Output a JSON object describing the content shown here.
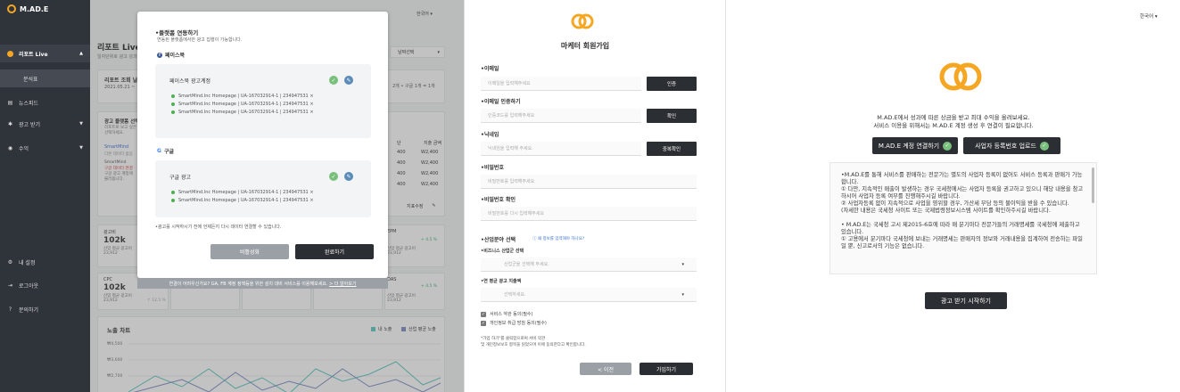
{
  "sidebar": {
    "logo": "M.AD.E",
    "items": [
      {
        "label": "리포트 Live",
        "icon": "report-icon"
      },
      {
        "label": "분석표",
        "icon": ""
      },
      {
        "label": "뉴스피드",
        "icon": "newsfeed-icon"
      },
      {
        "label": "광고 받기",
        "icon": "ad-icon"
      },
      {
        "label": "수익",
        "icon": "revenue-icon"
      }
    ],
    "bottom": [
      {
        "label": "내 설정",
        "icon": "gear-icon"
      },
      {
        "label": "로그아웃",
        "icon": "logout-icon"
      },
      {
        "label": "문의하기",
        "icon": "help-icon"
      }
    ]
  },
  "dashboard": {
    "lang": "한국어",
    "title": "리포트 Live",
    "subtitle": "일자단위로 광고 성과",
    "date_select": "날짜선택",
    "report_label": "리포트 조회 날짜",
    "report_date": "2021.05.21 ~",
    "report_right": "2개 • 구글 1개 = 1개",
    "platform_title": "광고 플랫폼 선택",
    "platform_desc1": "리포트로 보고 싶은",
    "platform_desc2": "선택하세요.",
    "smartmind": "SmartMind",
    "smartmind_sub": "다른 데이터 없음",
    "smartmind2": "SmartMind",
    "warn1": "구글 데이터 연결",
    "warn2": "구글 광고 계정에",
    "warn3": "불러옵니다.",
    "col_unit": "단",
    "col_amount": "지출 금액",
    "rows": [
      {
        "u": "400",
        "a": "W2,400"
      },
      {
        "u": "400",
        "a": "W2,400"
      },
      {
        "u": "400",
        "a": "W2,400"
      },
      {
        "u": "400",
        "a": "W2,400"
      }
    ],
    "edit_label": "지표수정",
    "metrics": [
      {
        "name": "광고비",
        "value": "102k",
        "sub1": "산업 평균 광고비",
        "sub2": "23,912",
        "pct": "↑ 12.5 %"
      },
      {
        "name": "EPM",
        "value": "",
        "sub1": "산업 평균 광고비",
        "sub2": "23,912",
        "pct": "+ 4.5 %"
      },
      {
        "name": "CPC",
        "value": "102k",
        "sub1": "산업 평균 광고비",
        "sub2": "23,912",
        "pct": "↑ 12.5 %"
      },
      {
        "name": "OAS",
        "value": "",
        "sub1": "산업 평균 광고비",
        "sub2": "23,912",
        "pct": "+ 4.5 %"
      }
    ],
    "chart_title": "노출 차트",
    "legend_a": "내 노출",
    "legend_b": "산업 평균 노출",
    "y_ticks": [
      "₩4,500",
      "₩3,600",
      "₩2,700"
    ]
  },
  "modal": {
    "title": "•플랫폼 연동하기",
    "desc": "연동된 플랫폼에서만 광고 집행이 가능합니다.",
    "facebook": "페이스북",
    "fb_account": "페이스북 광고계정",
    "google": "구글",
    "g_account": "구글 광고",
    "links": [
      "SmartMind.Inc Homepage | UA-167032914-1 | 234947531 ×",
      "SmartMind.Inc Homepage | UA-167032914-1 | 234947531 ×",
      "SmartMind.Inc Homepage | UA-167032914-1 | 234947531 ×"
    ],
    "glinks": [
      "SmartMind.Inc Homepage | UA-167032914-1 | 234947531 ×",
      "SmartMind.Inc Homepage | UA-167032914-1 | 234947531 ×"
    ],
    "note": "•광고를 시작하시기 전에 언제든지 다시 데이터 연결할 수 있습니다.",
    "btn_disable": "비활성화",
    "btn_done": "완료하기",
    "footnote": "연결이 어려우신가요? GA, FB 계정 정책등을 위한 설치 대비 서비스를 이용해보세요.",
    "footnote_link": "> 더 알아보기"
  },
  "signup": {
    "title": "마케터 회원가입",
    "email_label": "•이메일",
    "email_ph": "이메일을 입력해주세요",
    "email_btn": "인증",
    "verify_label": "•이메일 인증하기",
    "verify_ph": "인증코드를 입력해주세요",
    "verify_btn": "확인",
    "nick_label": "•닉네임",
    "nick_ph": "닉네임을 입력해 주세요.",
    "nick_btn": "중복확인",
    "pw_label": "•비밀번호",
    "pw_ph": "비밀번호를 입력해주세요",
    "pw2_label": "•비밀번호 확인",
    "pw2_ph": "비밀번호를 다시 입력해주세요",
    "industry_label": "•산업분야 선택",
    "industry_hint": "ⓘ 왜 정보를 입력해야 하나요?",
    "biz_label": "•비즈니스 산업군 선택",
    "biz_ph": "산업군을 선택해 주세요.",
    "budget_label": "•연 평균 광고 지출액",
    "budget_ph": "선택하세요.",
    "agree1": "서비스 약관 동의(필수)",
    "agree2": "개인정보 취급 방침 동의(필수)",
    "legal1": "*가입 하기\"를 클릭함으로써 서비 약관",
    "legal2": "및 개인정보보호 항목을 읽었으며 이에 동의한다고 확인합니다.",
    "prev": "< 이전",
    "submit": "가입하기"
  },
  "onboard": {
    "lang": "한국어",
    "line1": "M.AD.E에서 성과에 따른 상금을 받고 최대 수익을 올려보세요.",
    "line2": "서비스 이용을 위해서는 M.AD.E 계정 생성 후 연결이 필요합니다.",
    "btn_connect": "M.AD.E 계정 연결하기",
    "btn_biz": "사업자 등록번호 업로드",
    "terms": [
      "•M.AD.E를 통해 서비스를 판매하는 전문가는 별도의 사업자 등록이 없어도 서비스 등록과 판매가 가능합니다.",
      "① 다만, 지속적인 매출이 발생하는 경우 국세청에서는 사업자 등록을 권고하고 있으니 해당 내용을 참고하시어 사업자 등록 여부를 진행해주시길 바랍니다.",
      "② 사업자등록 없이 지속적으로 사업을 영위할 경우, 가산세 부담 등의 불이익을 받을 수 있습니다.",
      "(자세한 내용은 국세청 사이트 또는 국제법령정보시스템 사이트를 확인하주시길 바랍니다.",
      "",
      "• M.AD.E는 국세청 고시 제2015-6호에 따라 매 분기마다 전문가들의 거래명세를 국세청에 제출하고 있습니다.",
      "① 고용에서 분기마다 국세청에 보내는 거래명세는 판매자의 정보와 거래내용을 집계하여 전송하는 파일일 뿐, 신고로서의 기능은 없습니다."
    ],
    "start": "광고 받기 시작하기"
  },
  "colors": {
    "accent": "#f5a623",
    "dark": "#2b2e33",
    "teal": "#5cc8c0",
    "slate": "#7b8cc4"
  }
}
